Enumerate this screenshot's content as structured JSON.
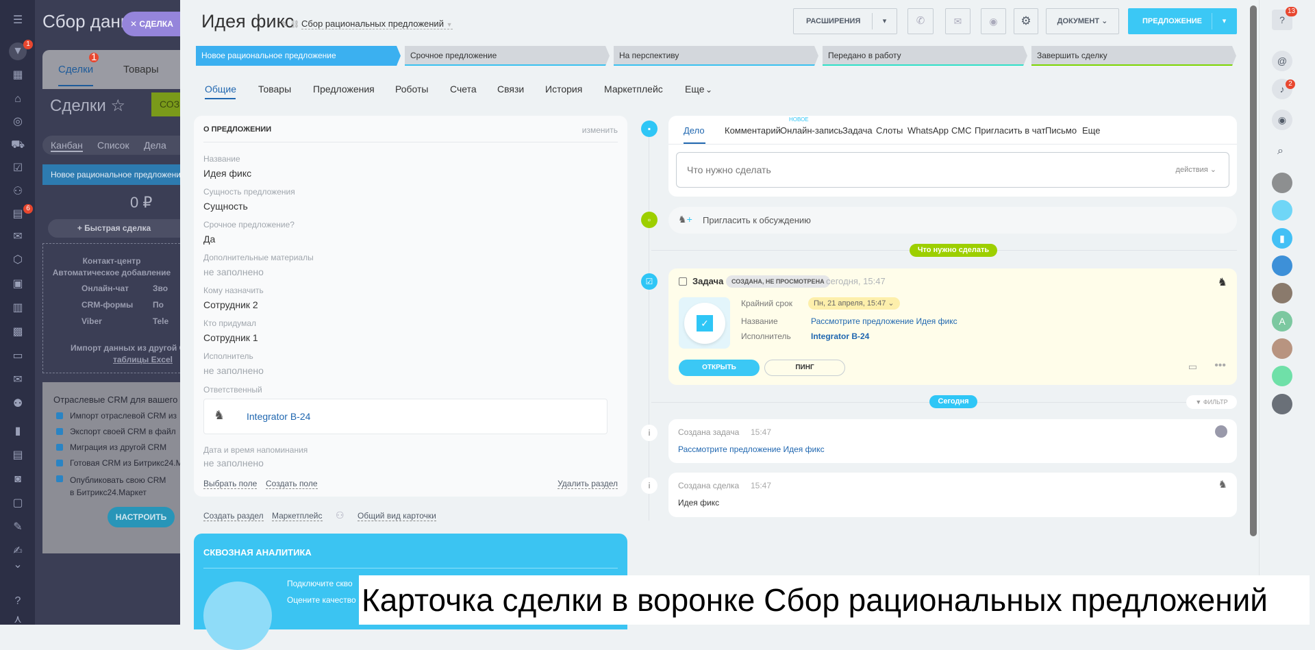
{
  "background_app": {
    "title": "Сбор данн",
    "close_tab": "СДЕЛКА",
    "tabs": [
      {
        "label": "Сделки",
        "badge": "1"
      },
      {
        "label": "Товары"
      }
    ],
    "menu_badge": "1",
    "tasks_badge": "6",
    "heading": "Сделки",
    "create_button": "СОЗ",
    "views": [
      "Канбан",
      "Список",
      "Дела"
    ],
    "column_title": "Новое рациональное предложение",
    "column_sum": "0 ₽",
    "quick_deal": "Быстрая сделка",
    "contact_center": {
      "title": "Контакт-центр",
      "subtitle": "Автоматическое добавление",
      "items": [
        "Онлайн-чат",
        "Зво",
        "CRM-формы",
        "По",
        "Viber",
        "Tele"
      ],
      "import_text": "Импорт данных из другой С",
      "import_link": "таблицы Excel"
    },
    "industry_crm": {
      "title": "Отраслевые CRM для вашего",
      "items": [
        "Импорт отраслевой CRM из",
        "Экспорт своей CRM в файл",
        "Миграция из другой CRM",
        "Готовая CRM из Битрикс24.М",
        "Опубликовать свою CRM в Битрикс24.Маркет"
      ],
      "button": "НАСТРОИТЬ"
    }
  },
  "header": {
    "title": "Идея фикс",
    "funnel": "Сбор рациональных предложений",
    "extensions": "РАСШИРЕНИЯ",
    "document": "ДОКУМЕНТ",
    "primary": "ПРЕДЛОЖЕНИЕ"
  },
  "stages": [
    {
      "label": "Новое рациональное предложение",
      "color": "#3bb0f0",
      "active": true
    },
    {
      "label": "Срочное предложение",
      "color": "#39c1f0"
    },
    {
      "label": "На перспективу",
      "color": "#39c1f0"
    },
    {
      "label": "Передано в работу",
      "color": "#2fe0c8"
    },
    {
      "label": "Завершить сделку",
      "color": "#7bd500"
    }
  ],
  "tabs": [
    "Общие",
    "Товары",
    "Предложения",
    "Роботы",
    "Счета",
    "Связи",
    "История",
    "Маркетплейс",
    "Еще"
  ],
  "about": {
    "title": "О ПРЕДЛОЖЕНИИ",
    "edit": "изменить",
    "fields": [
      {
        "label": "Название",
        "value": "Идея фикс"
      },
      {
        "label": "Сущность предложения",
        "value": "Сущность"
      },
      {
        "label": "Срочное предложение?",
        "value": "Да"
      },
      {
        "label": "Дополнительные материалы",
        "value": "не заполнено",
        "empty": true
      },
      {
        "label": "Кому назначить",
        "value": "Сотрудник 2"
      },
      {
        "label": "Кто придумал",
        "value": "Сотрудник 1"
      },
      {
        "label": "Исполнитель",
        "value": "не заполнено",
        "empty": true
      }
    ],
    "responsible_label": "Ответственный",
    "responsible": "Integrator B-24",
    "reminder_label": "Дата и время напоминания",
    "reminder_value": "не заполнено",
    "select_field": "Выбрать поле",
    "create_field": "Создать поле",
    "delete_section": "Удалить раздел"
  },
  "bottom_links": {
    "create_section": "Создать раздел",
    "market": "Маркетплейс",
    "common_view": "Общий вид карточки"
  },
  "analytics": {
    "title": "СКВОЗНАЯ АНАЛИТИКА",
    "line1": "Подключите скво",
    "line2": "Оцените качество"
  },
  "composer": {
    "tabs": [
      "Дело",
      "Комментарий",
      "Онлайн-запись",
      "Задача",
      "Слоты",
      "WhatsApp",
      "СМС",
      "Пригласить в чат",
      "Письмо",
      "Еще"
    ],
    "new_badge": "НОВОЕ",
    "placeholder": "Что нужно сделать",
    "actions": "действия"
  },
  "invite": "Пригласить к обсуждению",
  "todo_pill": "Что нужно сделать",
  "task": {
    "title": "Задача",
    "status": "СОЗДАНА, НЕ ПРОСМОТРЕНА",
    "time": "сегодня, 15:47",
    "deadline_label": "Крайний срок",
    "deadline": "Пн, 21 апреля, 15:47",
    "name_label": "Название",
    "name": "Рассмотрите предложение Идея фикс",
    "executor_label": "Исполнитель",
    "executor": "Integrator B-24",
    "open": "ОТКРЫТЬ",
    "ping": "ПИНГ"
  },
  "today_pill": "Сегодня",
  "filter": "ФИЛЬТР",
  "events": [
    {
      "title": "Создана задача",
      "time": "15:47",
      "text": "Рассмотрите предложение Идея фикс",
      "link": true
    },
    {
      "title": "Создана сделка",
      "time": "15:47",
      "text": "Идея фикс",
      "link": false
    }
  ],
  "right_panel": {
    "help_badge": "13",
    "notif_badge": "2",
    "avatar_letter": "A"
  },
  "caption": "Карточка сделки в воронке Сбор рациональных предложений",
  "colors": {
    "accent": "#3bc8f5",
    "green": "#9dcf00",
    "link": "#2067b0"
  }
}
